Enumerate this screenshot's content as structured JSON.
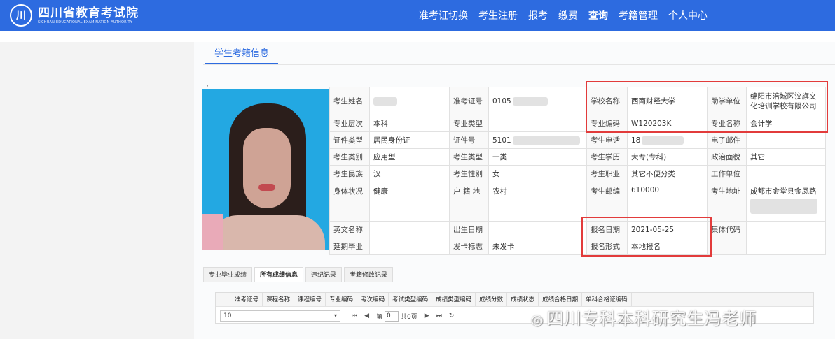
{
  "header": {
    "logo_cn": "四川省教育考试院",
    "logo_en": "SICHUAN EDUCATIONAL EXAMINATION AUTHORITY",
    "nav": [
      "准考证切换",
      "考生注册",
      "报考",
      "缴费",
      "查询",
      "考籍管理",
      "个人中心"
    ],
    "active_nav": "查询"
  },
  "section_title": "学生考籍信息",
  "info": {
    "row1": [
      "考生姓名",
      "",
      "准考证号",
      "0105",
      "学校名称",
      "西南财经大学",
      "助学单位",
      "绵阳市涪城区汶旗文化培训学校有限公司"
    ],
    "row2": [
      "专业层次",
      "本科",
      "专业类型",
      "",
      "专业编码",
      "W120203K",
      "专业名称",
      "会计学"
    ],
    "row3": [
      "证件类型",
      "居民身份证",
      "证件号",
      "5101",
      "考生电话",
      "18",
      "电子邮件",
      ""
    ],
    "row4": [
      "考生类别",
      "应用型",
      "考生类型",
      "一类",
      "考生学历",
      "大专(专科)",
      "政治面貌",
      "其它"
    ],
    "row5": [
      "考生民族",
      "汉",
      "考生性别",
      "女",
      "考生职业",
      "其它不便分类",
      "工作单位",
      ""
    ],
    "row6": [
      "身体状况",
      "健康",
      "户 籍 地",
      "农村",
      "考生邮编",
      "610000",
      "考生地址",
      "成都市金堂县金凤路"
    ],
    "row7": [
      "英文名称",
      "",
      "出生日期",
      "",
      "报名日期",
      "2021-05-25",
      "集体代码",
      ""
    ],
    "row8": [
      "延期毕业",
      "",
      "发卡标志",
      "未发卡",
      "报名形式",
      "本地报名",
      "",
      ""
    ]
  },
  "tabs": [
    "专业毕业成绩",
    "所有成绩信息",
    "违纪记录",
    "考籍修改记录"
  ],
  "active_tab": "所有成绩信息",
  "grid_columns": [
    "准考证号",
    "课程名称",
    "课程编号",
    "专业编码",
    "考次编码",
    "考试类型编码",
    "成绩类型编码",
    "成绩分数",
    "成绩状态",
    "成绩合格日期",
    "单科合格证编码"
  ],
  "pager": {
    "page_size": "10",
    "page_label_before": "第",
    "page_value": "0",
    "page_label_after": "共0页"
  },
  "watermark": "四川专科本科研究生冯老师",
  "colors": {
    "brand": "#2d6be0",
    "highlight_box": "#e23b3b"
  }
}
